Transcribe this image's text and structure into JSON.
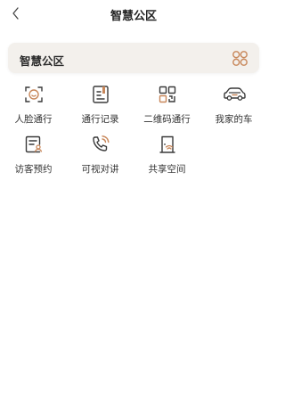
{
  "header": {
    "title": "智慧公区",
    "back_icon": "chevron-left-icon"
  },
  "banner": {
    "title": "智慧公区",
    "icon": "grid-four-circles-icon",
    "bg": "#f3f0ec"
  },
  "colors": {
    "icon_dark": "#3a3a3a",
    "icon_accent": "#c8875a"
  },
  "items": [
    {
      "label": "人脸通行",
      "icon": "face-scan-icon"
    },
    {
      "label": "通行记录",
      "icon": "record-book-icon"
    },
    {
      "label": "二维码通行",
      "icon": "qr-code-icon"
    },
    {
      "label": "我家的车",
      "icon": "car-icon"
    },
    {
      "label": "访客预约",
      "icon": "visitor-appointment-icon"
    },
    {
      "label": "可视对讲",
      "icon": "video-intercom-phone-icon"
    },
    {
      "label": "共享空间",
      "icon": "shared-space-door-icon"
    }
  ]
}
